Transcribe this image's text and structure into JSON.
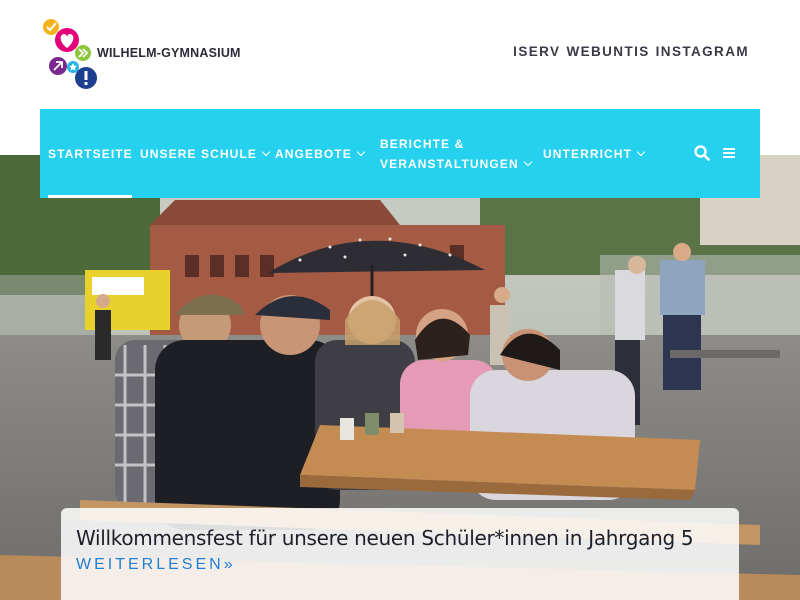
{
  "site": {
    "logo_text": "WILHELM-GYMNASIUM"
  },
  "top_links": [
    {
      "label": "ISERV"
    },
    {
      "label": "WEBUNTIS"
    },
    {
      "label": "INSTAGRAM"
    }
  ],
  "nav": {
    "items": [
      {
        "label": "STARTSEITE",
        "has_dropdown": false,
        "active": true
      },
      {
        "label": "UNSERE SCHULE",
        "has_dropdown": true
      },
      {
        "label": "ANGEBOTE",
        "has_dropdown": true
      },
      {
        "label_line1": "BERICHTE &",
        "label_line2": "VERANSTALTUNGEN",
        "has_dropdown": true
      },
      {
        "label": "UNTERRICHT",
        "has_dropdown": true
      }
    ],
    "icons": [
      "search-icon",
      "menu-icon"
    ]
  },
  "hero": {
    "caption_title": "Willkommensfest für unsere neuen Schüler*innen in Jahrgang 5",
    "read_more": "WEITERLESEN»"
  },
  "colors": {
    "nav_bg": "#26d0ef",
    "link_blue": "#1e7fd8",
    "text_dark": "#1f1f2a"
  }
}
